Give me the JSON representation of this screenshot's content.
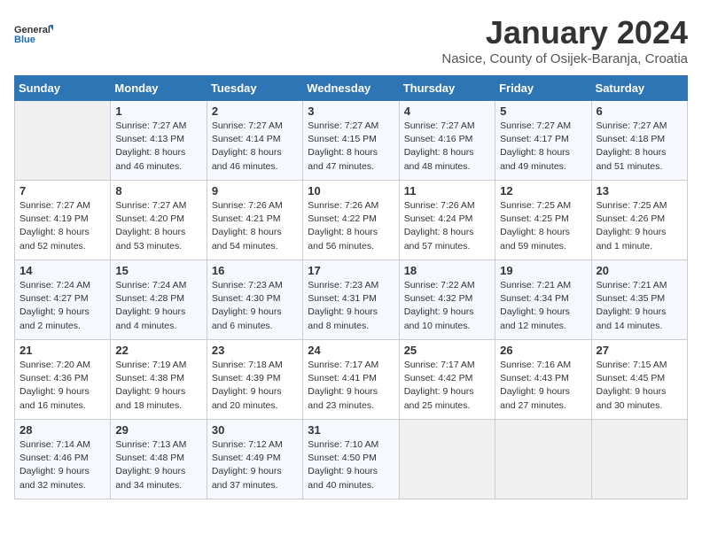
{
  "header": {
    "logo_line1": "General",
    "logo_line2": "Blue",
    "month_title": "January 2024",
    "location": "Nasice, County of Osijek-Baranja, Croatia"
  },
  "days_of_week": [
    "Sunday",
    "Monday",
    "Tuesday",
    "Wednesday",
    "Thursday",
    "Friday",
    "Saturday"
  ],
  "weeks": [
    [
      {
        "day": "",
        "sunrise": "",
        "sunset": "",
        "daylight": "",
        "empty": true
      },
      {
        "day": "1",
        "sunrise": "Sunrise: 7:27 AM",
        "sunset": "Sunset: 4:13 PM",
        "daylight": "Daylight: 8 hours and 46 minutes."
      },
      {
        "day": "2",
        "sunrise": "Sunrise: 7:27 AM",
        "sunset": "Sunset: 4:14 PM",
        "daylight": "Daylight: 8 hours and 46 minutes."
      },
      {
        "day": "3",
        "sunrise": "Sunrise: 7:27 AM",
        "sunset": "Sunset: 4:15 PM",
        "daylight": "Daylight: 8 hours and 47 minutes."
      },
      {
        "day": "4",
        "sunrise": "Sunrise: 7:27 AM",
        "sunset": "Sunset: 4:16 PM",
        "daylight": "Daylight: 8 hours and 48 minutes."
      },
      {
        "day": "5",
        "sunrise": "Sunrise: 7:27 AM",
        "sunset": "Sunset: 4:17 PM",
        "daylight": "Daylight: 8 hours and 49 minutes."
      },
      {
        "day": "6",
        "sunrise": "Sunrise: 7:27 AM",
        "sunset": "Sunset: 4:18 PM",
        "daylight": "Daylight: 8 hours and 51 minutes."
      }
    ],
    [
      {
        "day": "7",
        "sunrise": "Sunrise: 7:27 AM",
        "sunset": "Sunset: 4:19 PM",
        "daylight": "Daylight: 8 hours and 52 minutes."
      },
      {
        "day": "8",
        "sunrise": "Sunrise: 7:27 AM",
        "sunset": "Sunset: 4:20 PM",
        "daylight": "Daylight: 8 hours and 53 minutes."
      },
      {
        "day": "9",
        "sunrise": "Sunrise: 7:26 AM",
        "sunset": "Sunset: 4:21 PM",
        "daylight": "Daylight: 8 hours and 54 minutes."
      },
      {
        "day": "10",
        "sunrise": "Sunrise: 7:26 AM",
        "sunset": "Sunset: 4:22 PM",
        "daylight": "Daylight: 8 hours and 56 minutes."
      },
      {
        "day": "11",
        "sunrise": "Sunrise: 7:26 AM",
        "sunset": "Sunset: 4:24 PM",
        "daylight": "Daylight: 8 hours and 57 minutes."
      },
      {
        "day": "12",
        "sunrise": "Sunrise: 7:25 AM",
        "sunset": "Sunset: 4:25 PM",
        "daylight": "Daylight: 8 hours and 59 minutes."
      },
      {
        "day": "13",
        "sunrise": "Sunrise: 7:25 AM",
        "sunset": "Sunset: 4:26 PM",
        "daylight": "Daylight: 9 hours and 1 minute."
      }
    ],
    [
      {
        "day": "14",
        "sunrise": "Sunrise: 7:24 AM",
        "sunset": "Sunset: 4:27 PM",
        "daylight": "Daylight: 9 hours and 2 minutes."
      },
      {
        "day": "15",
        "sunrise": "Sunrise: 7:24 AM",
        "sunset": "Sunset: 4:28 PM",
        "daylight": "Daylight: 9 hours and 4 minutes."
      },
      {
        "day": "16",
        "sunrise": "Sunrise: 7:23 AM",
        "sunset": "Sunset: 4:30 PM",
        "daylight": "Daylight: 9 hours and 6 minutes."
      },
      {
        "day": "17",
        "sunrise": "Sunrise: 7:23 AM",
        "sunset": "Sunset: 4:31 PM",
        "daylight": "Daylight: 9 hours and 8 minutes."
      },
      {
        "day": "18",
        "sunrise": "Sunrise: 7:22 AM",
        "sunset": "Sunset: 4:32 PM",
        "daylight": "Daylight: 9 hours and 10 minutes."
      },
      {
        "day": "19",
        "sunrise": "Sunrise: 7:21 AM",
        "sunset": "Sunset: 4:34 PM",
        "daylight": "Daylight: 9 hours and 12 minutes."
      },
      {
        "day": "20",
        "sunrise": "Sunrise: 7:21 AM",
        "sunset": "Sunset: 4:35 PM",
        "daylight": "Daylight: 9 hours and 14 minutes."
      }
    ],
    [
      {
        "day": "21",
        "sunrise": "Sunrise: 7:20 AM",
        "sunset": "Sunset: 4:36 PM",
        "daylight": "Daylight: 9 hours and 16 minutes."
      },
      {
        "day": "22",
        "sunrise": "Sunrise: 7:19 AM",
        "sunset": "Sunset: 4:38 PM",
        "daylight": "Daylight: 9 hours and 18 minutes."
      },
      {
        "day": "23",
        "sunrise": "Sunrise: 7:18 AM",
        "sunset": "Sunset: 4:39 PM",
        "daylight": "Daylight: 9 hours and 20 minutes."
      },
      {
        "day": "24",
        "sunrise": "Sunrise: 7:17 AM",
        "sunset": "Sunset: 4:41 PM",
        "daylight": "Daylight: 9 hours and 23 minutes."
      },
      {
        "day": "25",
        "sunrise": "Sunrise: 7:17 AM",
        "sunset": "Sunset: 4:42 PM",
        "daylight": "Daylight: 9 hours and 25 minutes."
      },
      {
        "day": "26",
        "sunrise": "Sunrise: 7:16 AM",
        "sunset": "Sunset: 4:43 PM",
        "daylight": "Daylight: 9 hours and 27 minutes."
      },
      {
        "day": "27",
        "sunrise": "Sunrise: 7:15 AM",
        "sunset": "Sunset: 4:45 PM",
        "daylight": "Daylight: 9 hours and 30 minutes."
      }
    ],
    [
      {
        "day": "28",
        "sunrise": "Sunrise: 7:14 AM",
        "sunset": "Sunset: 4:46 PM",
        "daylight": "Daylight: 9 hours and 32 minutes."
      },
      {
        "day": "29",
        "sunrise": "Sunrise: 7:13 AM",
        "sunset": "Sunset: 4:48 PM",
        "daylight": "Daylight: 9 hours and 34 minutes."
      },
      {
        "day": "30",
        "sunrise": "Sunrise: 7:12 AM",
        "sunset": "Sunset: 4:49 PM",
        "daylight": "Daylight: 9 hours and 37 minutes."
      },
      {
        "day": "31",
        "sunrise": "Sunrise: 7:10 AM",
        "sunset": "Sunset: 4:50 PM",
        "daylight": "Daylight: 9 hours and 40 minutes."
      },
      {
        "day": "",
        "sunrise": "",
        "sunset": "",
        "daylight": "",
        "empty": true
      },
      {
        "day": "",
        "sunrise": "",
        "sunset": "",
        "daylight": "",
        "empty": true
      },
      {
        "day": "",
        "sunrise": "",
        "sunset": "",
        "daylight": "",
        "empty": true
      }
    ]
  ]
}
